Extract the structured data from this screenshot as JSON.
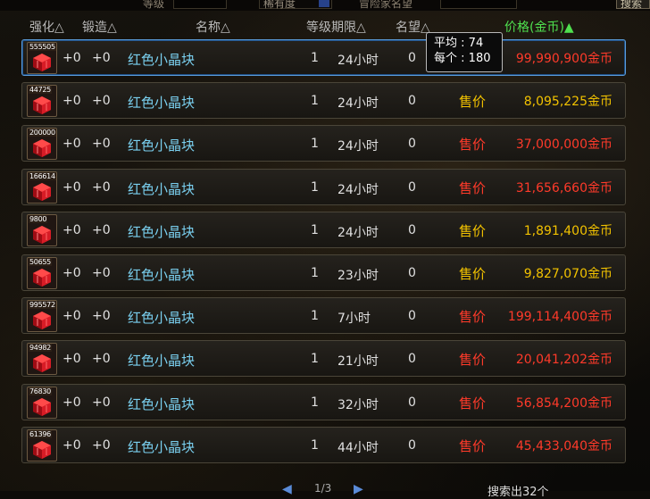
{
  "colors": {
    "sale_gold": "#f2c200",
    "sale_red": "#ff3a2a",
    "price_gold": "#f2c200",
    "price_red": "#ff3a2a",
    "price_header": "#4fe04f"
  },
  "topbar": {
    "level_label": "等级",
    "rarity_select": "稀有度",
    "reputation_label": "冒险家名望",
    "search_button": "搜索"
  },
  "header": {
    "strengthen": "强化△",
    "forge": "锻造△",
    "name": "名称△",
    "level_duration": "等级期限△",
    "reputation": "名望△",
    "price": "价格(金币)▲"
  },
  "tooltip": {
    "avg_label": "平均",
    "avg_value": ": 74",
    "each_label": "每个",
    "each_value": ": 180"
  },
  "rows": [
    {
      "qty": "555505",
      "strengthen": "+0",
      "forge": "+0",
      "name": "红色小晶块",
      "level": "1",
      "duration": "24小时",
      "reputation": "0",
      "sale": "",
      "price": "99,990,900金币",
      "price_color": "red",
      "selected": true
    },
    {
      "qty": "44725",
      "strengthen": "+0",
      "forge": "+0",
      "name": "红色小晶块",
      "level": "1",
      "duration": "24小时",
      "reputation": "0",
      "sale": "售价",
      "sale_color": "gold",
      "price": "8,095,225金币",
      "price_color": "gold"
    },
    {
      "qty": "200000",
      "strengthen": "+0",
      "forge": "+0",
      "name": "红色小晶块",
      "level": "1",
      "duration": "24小时",
      "reputation": "0",
      "sale": "售价",
      "sale_color": "red",
      "price": "37,000,000金币",
      "price_color": "red"
    },
    {
      "qty": "166614",
      "strengthen": "+0",
      "forge": "+0",
      "name": "红色小晶块",
      "level": "1",
      "duration": "24小时",
      "reputation": "0",
      "sale": "售价",
      "sale_color": "red",
      "price": "31,656,660金币",
      "price_color": "red"
    },
    {
      "qty": "9800",
      "strengthen": "+0",
      "forge": "+0",
      "name": "红色小晶块",
      "level": "1",
      "duration": "24小时",
      "reputation": "0",
      "sale": "售价",
      "sale_color": "gold",
      "price": "1,891,400金币",
      "price_color": "gold"
    },
    {
      "qty": "50655",
      "strengthen": "+0",
      "forge": "+0",
      "name": "红色小晶块",
      "level": "1",
      "duration": "23小时",
      "reputation": "0",
      "sale": "售价",
      "sale_color": "gold",
      "price": "9,827,070金币",
      "price_color": "gold"
    },
    {
      "qty": "995572",
      "strengthen": "+0",
      "forge": "+0",
      "name": "红色小晶块",
      "level": "1",
      "duration": "7小时",
      "reputation": "0",
      "sale": "售价",
      "sale_color": "red",
      "price": "199,114,400金币",
      "price_color": "red"
    },
    {
      "qty": "94982",
      "strengthen": "+0",
      "forge": "+0",
      "name": "红色小晶块",
      "level": "1",
      "duration": "21小时",
      "reputation": "0",
      "sale": "售价",
      "sale_color": "red",
      "price": "20,041,202金币",
      "price_color": "red"
    },
    {
      "qty": "76830",
      "strengthen": "+0",
      "forge": "+0",
      "name": "红色小晶块",
      "level": "1",
      "duration": "32小时",
      "reputation": "0",
      "sale": "售价",
      "sale_color": "red",
      "price": "56,854,200金币",
      "price_color": "red"
    },
    {
      "qty": "61396",
      "strengthen": "+0",
      "forge": "+0",
      "name": "红色小晶块",
      "level": "1",
      "duration": "44小时",
      "reputation": "0",
      "sale": "售价",
      "sale_color": "red",
      "price": "45,433,040金币",
      "price_color": "red"
    }
  ],
  "pager": {
    "prev": "◀",
    "page": "1/3",
    "next": "▶",
    "found": "搜索出32个"
  }
}
